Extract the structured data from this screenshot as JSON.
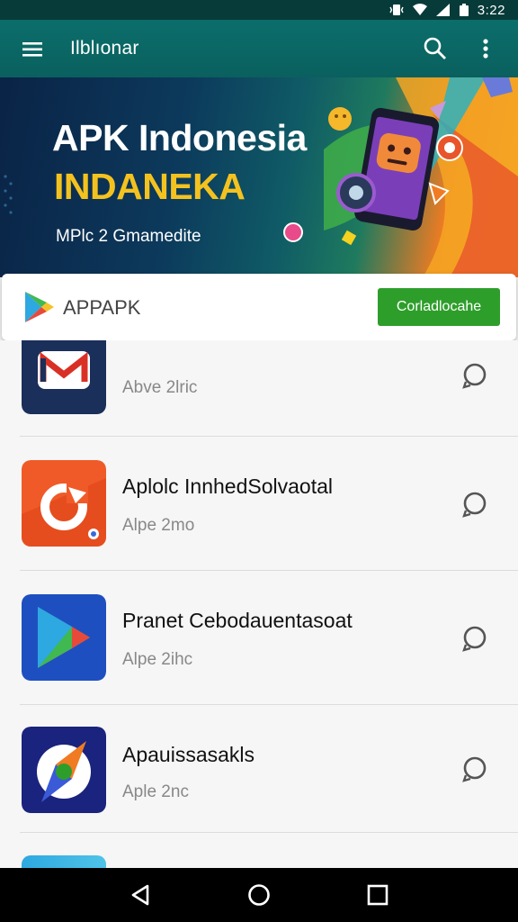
{
  "status_bar": {
    "time": "3:22",
    "icons": [
      "vibrate-icon",
      "wifi-icon",
      "signal-icon",
      "battery-icon"
    ]
  },
  "app_bar": {
    "title": "Ilblıonar",
    "icons": [
      "menu-icon",
      "search-icon",
      "more-vert-icon"
    ]
  },
  "banner": {
    "title": "APK Indonesia",
    "subtitle": "INDANEKA",
    "tagline": "MPlc 2 Gmamedite"
  },
  "appapk_card": {
    "label": "APPAPK",
    "button_label": "Corladlocahe",
    "colors": {
      "button": "#2e9e2b"
    }
  },
  "apps": [
    {
      "name": "",
      "subtitle": "Abve 2lric",
      "icon": "gmail-style-icon"
    },
    {
      "name": "Aplolc InnhedSolvaotal",
      "subtitle": "Alpe 2mo",
      "icon": "orange-refresh-icon"
    },
    {
      "name": "Pranet Cebodauentasoat",
      "subtitle": "Alpe 2ihc",
      "icon": "play-triangle-icon"
    },
    {
      "name": "Apauissasakls",
      "subtitle": "Aple 2nc",
      "icon": "compass-icon"
    }
  ],
  "nav_bar": {
    "icons": [
      "back-icon",
      "home-icon",
      "recents-icon"
    ]
  },
  "colors": {
    "app_bar": "#0b6e6b",
    "status_bar": "#073b3a",
    "banner_accent": "#f4c21f"
  }
}
